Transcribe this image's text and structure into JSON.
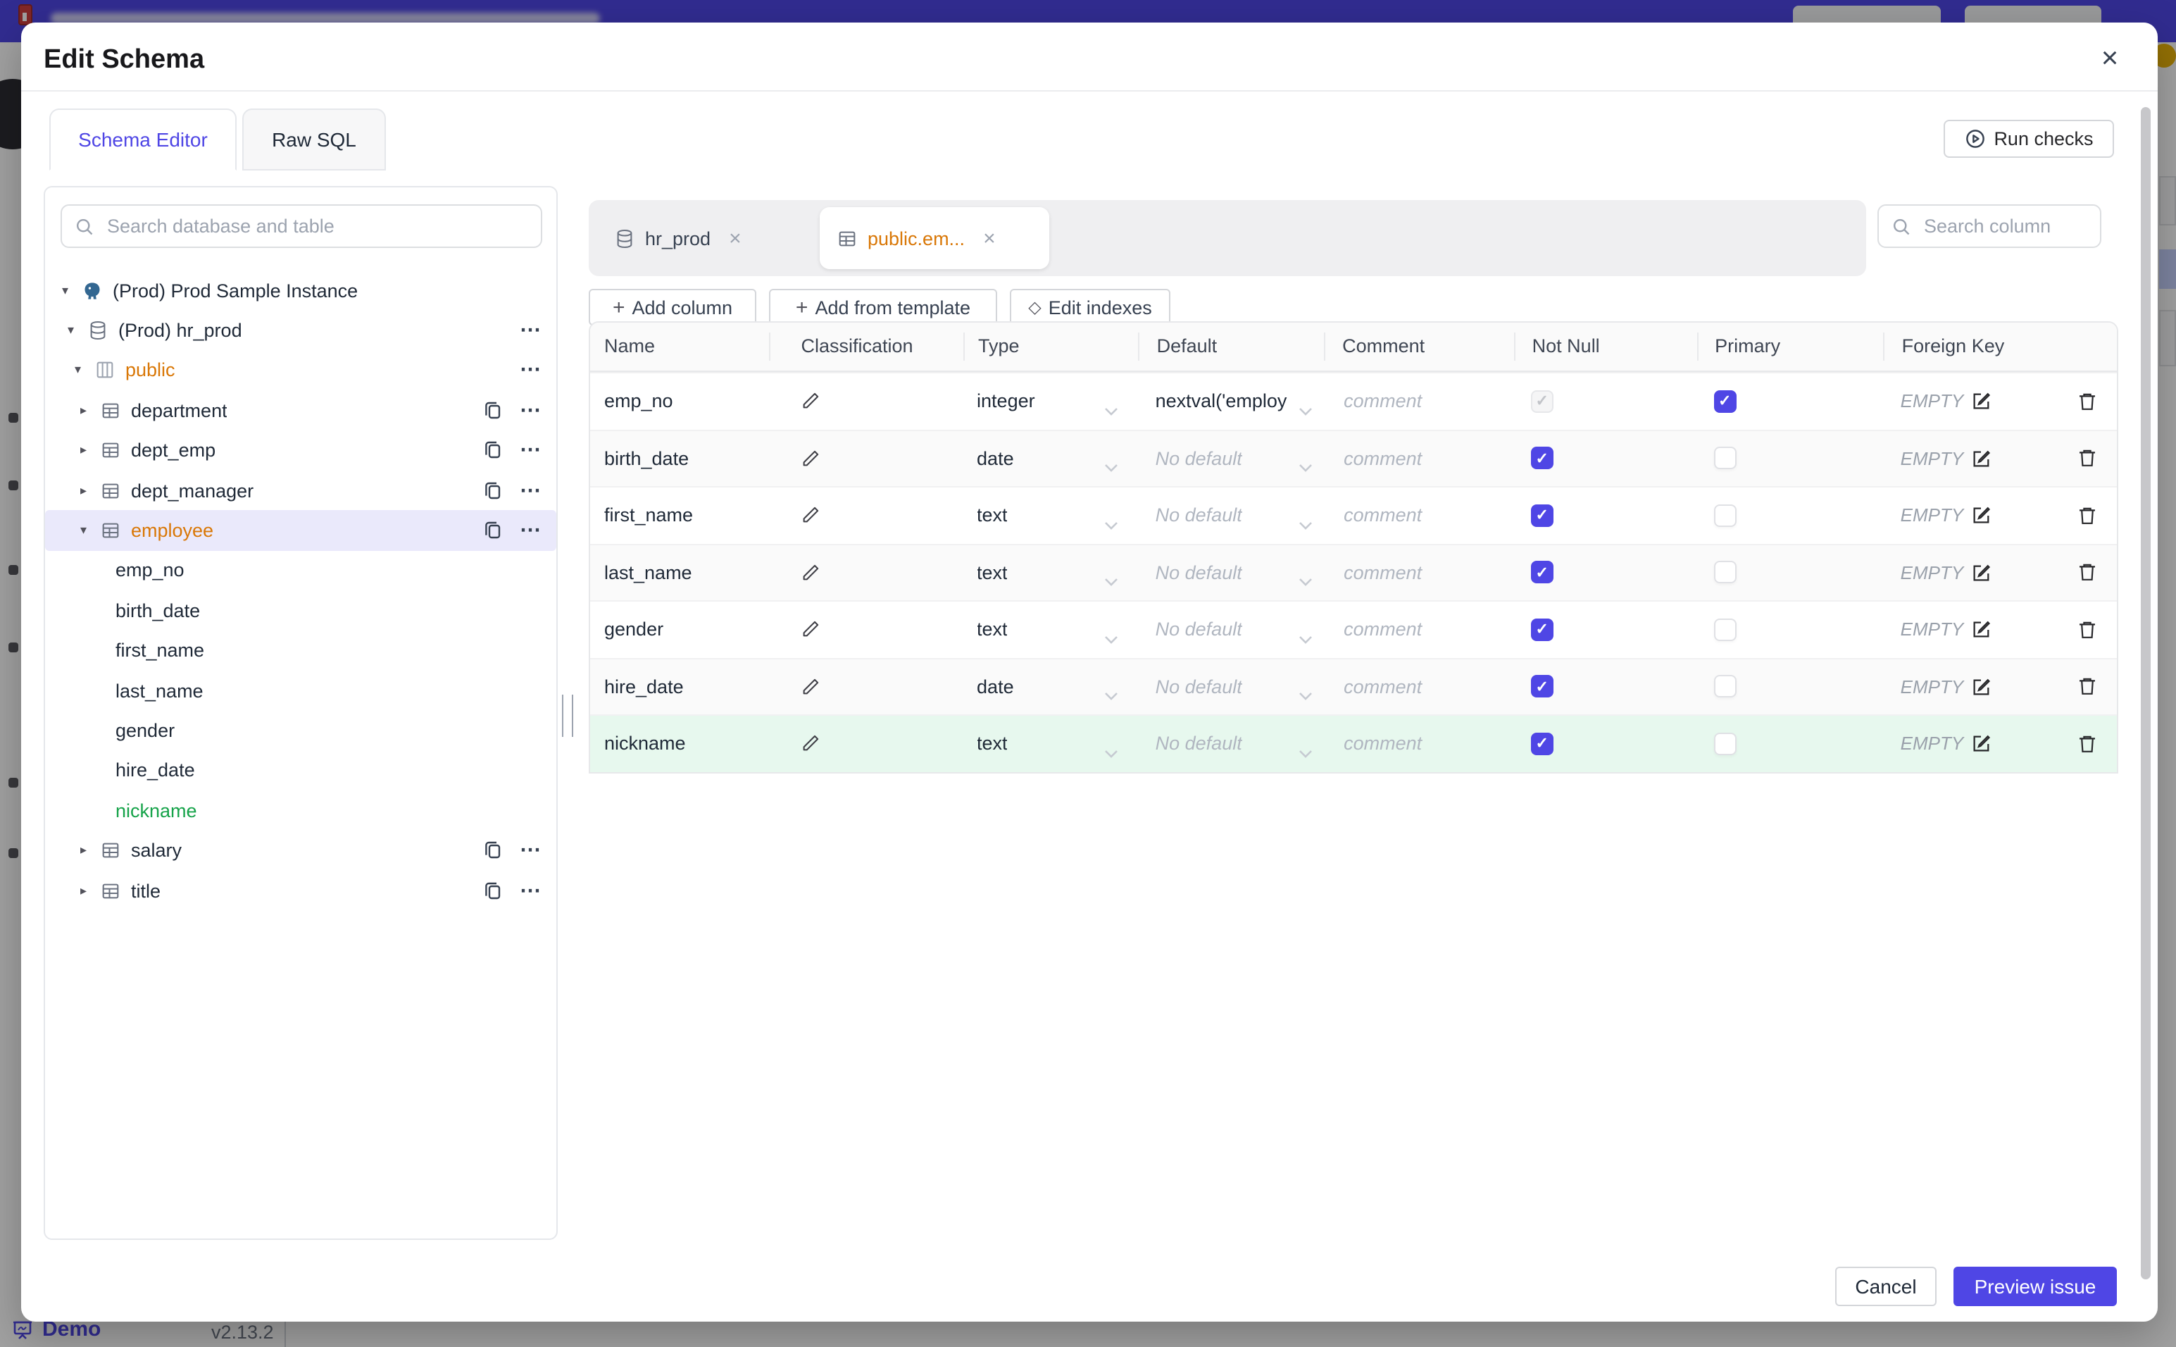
{
  "icons": {
    "plus": "+",
    "diamond": "◇",
    "more": "⋯",
    "caret_down": "▾",
    "caret_right": "▸",
    "close": "×",
    "check": "✓"
  },
  "backdrop": {
    "demo_label": "Demo",
    "version": "v2.13.2"
  },
  "modal": {
    "title": "Edit Schema",
    "run_checks_label": "Run checks",
    "tabs": [
      {
        "label": "Schema Editor",
        "active": true
      },
      {
        "label": "Raw SQL",
        "active": false
      }
    ],
    "sidebar": {
      "search_placeholder": "Search database and table",
      "tree": [
        {
          "label": "(Prod) Prod Sample Instance",
          "level": 0,
          "type": "instance",
          "expanded": true
        },
        {
          "label": "(Prod) hr_prod",
          "level": 1,
          "type": "database",
          "expanded": true
        },
        {
          "label": "public",
          "level": 2,
          "type": "schema",
          "expanded": true,
          "modified": true
        },
        {
          "label": "department",
          "level": 3,
          "type": "table",
          "expanded": false
        },
        {
          "label": "dept_emp",
          "level": 3,
          "type": "table",
          "expanded": false
        },
        {
          "label": "dept_manager",
          "level": 3,
          "type": "table",
          "expanded": false
        },
        {
          "label": "employee",
          "level": 3,
          "type": "table",
          "expanded": true,
          "selected": true,
          "modified": true
        },
        {
          "label": "emp_no",
          "level": 4,
          "type": "column"
        },
        {
          "label": "birth_date",
          "level": 4,
          "type": "column"
        },
        {
          "label": "first_name",
          "level": 4,
          "type": "column"
        },
        {
          "label": "last_name",
          "level": 4,
          "type": "column"
        },
        {
          "label": "gender",
          "level": 4,
          "type": "column"
        },
        {
          "label": "hire_date",
          "level": 4,
          "type": "column"
        },
        {
          "label": "nickname",
          "level": 4,
          "type": "column",
          "added": true
        },
        {
          "label": "salary",
          "level": 3,
          "type": "table",
          "expanded": false
        },
        {
          "label": "title",
          "level": 3,
          "type": "table",
          "expanded": false
        }
      ]
    },
    "editor": {
      "tabs": [
        {
          "label": "hr_prod",
          "type": "database",
          "active": false
        },
        {
          "label": "public.em...",
          "type": "table",
          "active": true,
          "modified": true
        }
      ],
      "search_placeholder": "Search column",
      "toolbar": {
        "add_column": "Add column",
        "add_from_template": "Add from template",
        "edit_indexes": "Edit indexes"
      },
      "table": {
        "headers": [
          "Name",
          "Classification",
          "Type",
          "Default",
          "Comment",
          "Not Null",
          "Primary",
          "Foreign Key"
        ],
        "rows": [
          {
            "name": "emp_no",
            "type": "integer",
            "default": "nextval('employ",
            "comment": "comment",
            "not_null": true,
            "not_null_disabled": true,
            "primary": true,
            "foreign_key": "EMPTY"
          },
          {
            "name": "birth_date",
            "type": "date",
            "default": "No default",
            "comment": "comment",
            "not_null": true,
            "primary": false,
            "foreign_key": "EMPTY"
          },
          {
            "name": "first_name",
            "type": "text",
            "default": "No default",
            "comment": "comment",
            "not_null": true,
            "primary": false,
            "foreign_key": "EMPTY"
          },
          {
            "name": "last_name",
            "type": "text",
            "default": "No default",
            "comment": "comment",
            "not_null": true,
            "primary": false,
            "foreign_key": "EMPTY"
          },
          {
            "name": "gender",
            "type": "text",
            "default": "No default",
            "comment": "comment",
            "not_null": true,
            "primary": false,
            "foreign_key": "EMPTY"
          },
          {
            "name": "hire_date",
            "type": "date",
            "default": "No default",
            "comment": "comment",
            "not_null": true,
            "primary": false,
            "foreign_key": "EMPTY"
          },
          {
            "name": "nickname",
            "type": "text",
            "default": "No default",
            "comment": "comment",
            "not_null": true,
            "primary": false,
            "foreign_key": "EMPTY",
            "added": true
          }
        ]
      }
    },
    "footer": {
      "cancel": "Cancel",
      "submit": "Preview issue"
    }
  }
}
